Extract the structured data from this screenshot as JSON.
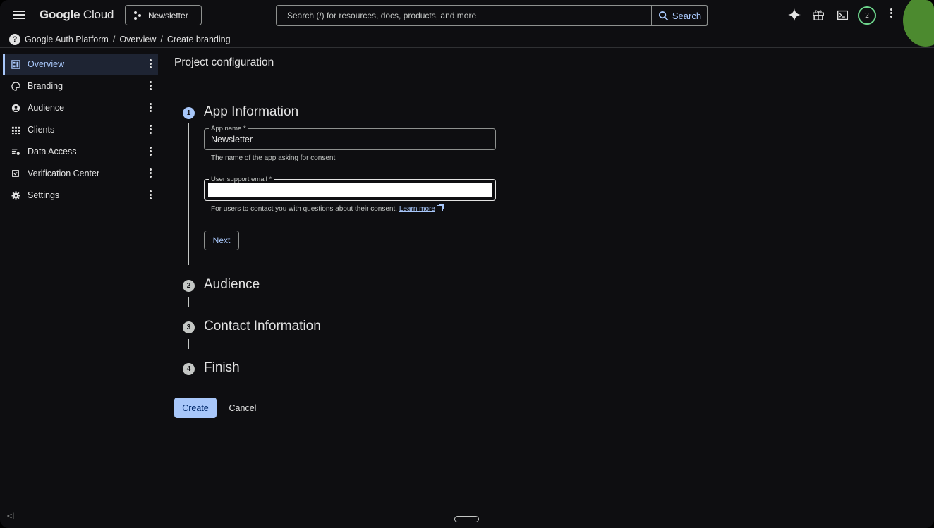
{
  "header": {
    "brand_bold": "Google",
    "brand_rest": " Cloud",
    "project": "Newsletter",
    "search_placeholder": "Search (/) for resources, docs, products, and more",
    "search_button": "Search",
    "notifications_count": "2"
  },
  "breadcrumb": {
    "items": [
      "Google Auth Platform",
      "Overview",
      "Create branding"
    ],
    "separator": "/"
  },
  "sidebar": {
    "items": [
      {
        "label": "Overview",
        "icon": "dashboard-icon",
        "active": true
      },
      {
        "label": "Branding",
        "icon": "palette-icon"
      },
      {
        "label": "Audience",
        "icon": "account-circle-icon"
      },
      {
        "label": "Clients",
        "icon": "grid-apps-icon"
      },
      {
        "label": "Data Access",
        "icon": "filter-settings-icon"
      },
      {
        "label": "Verification Center",
        "icon": "checkbox-icon"
      },
      {
        "label": "Settings",
        "icon": "gear-icon"
      }
    ],
    "collapse_label": "<I"
  },
  "main": {
    "title": "Project configuration",
    "steps": [
      {
        "number": "1",
        "title": "App Information"
      },
      {
        "number": "2",
        "title": "Audience"
      },
      {
        "number": "3",
        "title": "Contact Information"
      },
      {
        "number": "4",
        "title": "Finish"
      }
    ],
    "app_name": {
      "label": "App name *",
      "value": "Newsletter",
      "helper": "The name of the app asking for consent"
    },
    "support_email": {
      "label": "User support email *",
      "value": "",
      "helper": "For users to contact you with questions about their consent.",
      "link": "Learn more"
    },
    "next_label": "Next",
    "create_label": "Create",
    "cancel_label": "Cancel"
  },
  "colors": {
    "accent": "#a8c7fa",
    "background": "#0e0e11",
    "badge_ring": "#6dd58c",
    "avatar": "#4c8a2f"
  }
}
